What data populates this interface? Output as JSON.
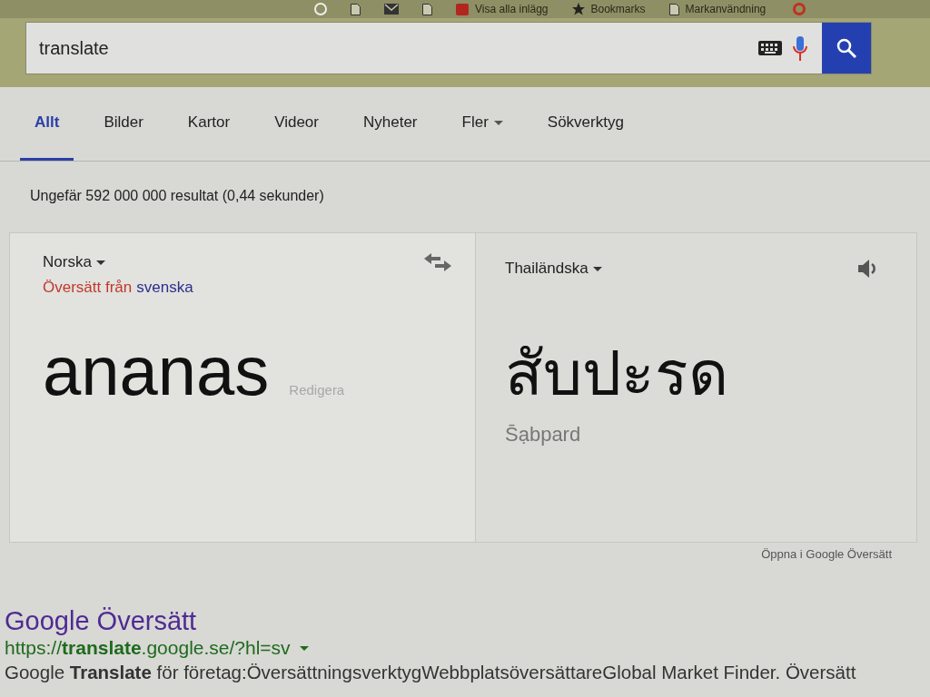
{
  "bookmarks_bar": {
    "items": [
      {
        "label": "Visa alla inlägg"
      },
      {
        "label": "Bookmarks"
      },
      {
        "label": "Markanvändning"
      }
    ]
  },
  "search": {
    "value": "translate"
  },
  "tabs": [
    {
      "label": "Allt",
      "selected": true,
      "kind": "tab"
    },
    {
      "label": "Bilder",
      "selected": false,
      "kind": "tab"
    },
    {
      "label": "Kartor",
      "selected": false,
      "kind": "tab"
    },
    {
      "label": "Videor",
      "selected": false,
      "kind": "tab"
    },
    {
      "label": "Nyheter",
      "selected": false,
      "kind": "tab"
    },
    {
      "label": "Fler",
      "selected": false,
      "kind": "menu"
    },
    {
      "label": "Sökverktyg",
      "selected": false,
      "kind": "tab"
    }
  ],
  "result_stats": "Ungefär 592 000 000 resultat (0,44 sekunder)",
  "translator": {
    "source": {
      "language": "Norska",
      "detected_prefix": "Översätt från",
      "detected_language": "svenska",
      "text": "ananas",
      "edit_label": "Redigera"
    },
    "target": {
      "language": "Thailändska",
      "text": "สับปะรด",
      "transliteration": "S̄ạbpard"
    },
    "open_link": "Öppna i Google Översätt"
  },
  "results": [
    {
      "title": "Google Översätt",
      "url": "https://**translate**.google.se/?hl=sv",
      "snippet": "Google **Translate** för företag:ÖversättningsverktygWebbplatsöversättareGlobal Market Finder. Översätt"
    }
  ]
}
